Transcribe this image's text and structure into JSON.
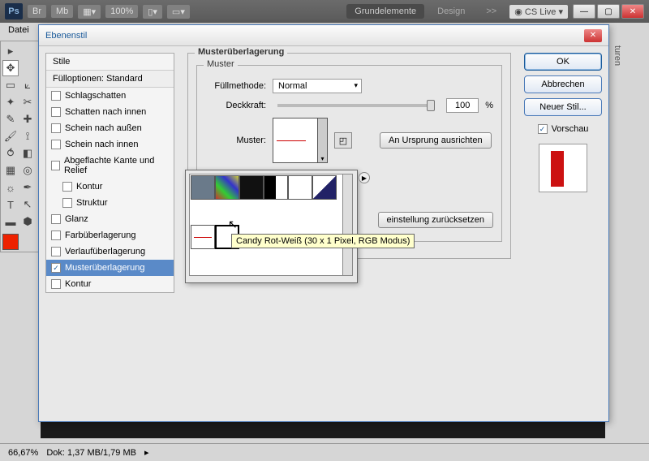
{
  "app": {
    "logo": "Ps",
    "br": "Br",
    "mb": "Mb",
    "zoom": "100%",
    "tabs": {
      "grund": "Grundelemente",
      "design": "Design",
      "more": ">>"
    },
    "cslive": "CS Live"
  },
  "menu": {
    "file": "Datei"
  },
  "status": {
    "zoom": "66,67%",
    "doc": "Dok: 1,37 MB/1,79 MB"
  },
  "rightTab": "turen",
  "dialog": {
    "title": "Ebenenstil",
    "styles": {
      "header": "Stile",
      "blend": "Fülloptionen: Standard",
      "items": {
        "drop": "Schlagschatten",
        "inner": "Schatten nach innen",
        "outerglow": "Schein nach außen",
        "innerglow": "Schein nach innen",
        "bevel": "Abgeflachte Kante und Relief",
        "contour": "Kontur",
        "texture": "Struktur",
        "satin": "Glanz",
        "color": "Farbüberlagerung",
        "gradient": "Verlaufüberlagerung",
        "pattern": "Musterüberlagerung",
        "stroke": "Kontur"
      }
    },
    "content": {
      "section": "Musterüberlagerung",
      "subsection": "Muster",
      "blendLabel": "Füllmethode:",
      "blendValue": "Normal",
      "opacityLabel": "Deckkraft:",
      "opacityValue": "100",
      "opacityUnit": "%",
      "patternLabel": "Muster:",
      "snapBtn": "An Ursprung ausrichten",
      "resetBtn": "einstellung zurücksetzen",
      "tooltip": "Candy Rot-Weiß (30 x 1 Pixel, RGB Modus)"
    },
    "actions": {
      "ok": "OK",
      "cancel": "Abbrechen",
      "new": "Neuer Stil...",
      "preview": "Vorschau"
    }
  }
}
